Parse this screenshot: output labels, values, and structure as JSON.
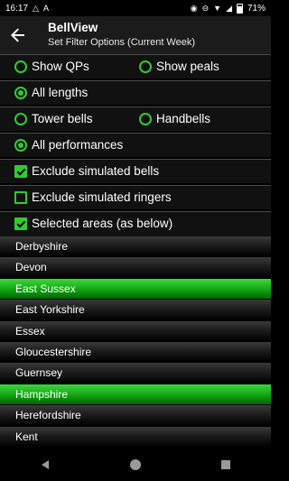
{
  "status_bar": {
    "time": "16:17",
    "battery": "71%"
  },
  "app_bar": {
    "title": "BellView",
    "subtitle": "Set Filter Options (Current Week)"
  },
  "filters": {
    "row1": {
      "show_qps": {
        "label": "Show QPs",
        "selected": false
      },
      "show_peals": {
        "label": "Show peals",
        "selected": false
      }
    },
    "row2": {
      "all_lengths": {
        "label": "All lengths",
        "selected": true
      }
    },
    "row3": {
      "tower_bells": {
        "label": "Tower bells",
        "selected": false
      },
      "handbells": {
        "label": "Handbells",
        "selected": false
      }
    },
    "row4": {
      "all_performances": {
        "label": "All performances",
        "selected": true
      }
    },
    "exclude_simulated_bells": {
      "label": "Exclude simulated bells",
      "checked": true
    },
    "exclude_simulated_ringers": {
      "label": "Exclude simulated ringers",
      "checked": false
    },
    "selected_areas": {
      "label": "Selected areas (as below)",
      "checked": true
    }
  },
  "counties": [
    {
      "name": "Derbyshire",
      "selected": false
    },
    {
      "name": "Devon",
      "selected": false
    },
    {
      "name": "East Sussex",
      "selected": true
    },
    {
      "name": "East Yorkshire",
      "selected": false
    },
    {
      "name": "Essex",
      "selected": false
    },
    {
      "name": "Gloucestershire",
      "selected": false
    },
    {
      "name": "Guernsey",
      "selected": false
    },
    {
      "name": "Hampshire",
      "selected": true
    },
    {
      "name": "Herefordshire",
      "selected": false
    },
    {
      "name": "Kent",
      "selected": false
    }
  ],
  "colors": {
    "accent_green": "#2ecc2e",
    "selected_row_green": "#17b017"
  }
}
